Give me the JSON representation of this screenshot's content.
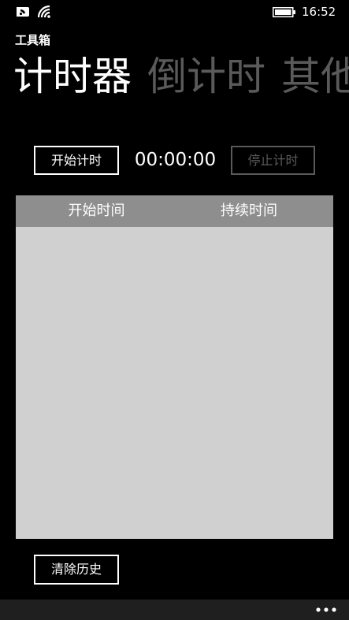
{
  "status_bar": {
    "time": "16:52",
    "icons": [
      "signal-icon",
      "wifi-icon",
      "battery-icon"
    ]
  },
  "app": {
    "title": "工具箱"
  },
  "pivot": {
    "items": [
      {
        "label": "计时器",
        "active": true
      },
      {
        "label": "倒计时",
        "active": false
      },
      {
        "label": "其他",
        "active": false
      }
    ]
  },
  "timer": {
    "start_label": "开始计时",
    "display": "00:00:00",
    "stop_label": "停止计时",
    "stop_enabled": false
  },
  "history": {
    "columns": [
      "开始时间",
      "持续时间"
    ],
    "rows": []
  },
  "actions": {
    "clear_label": "清除历史"
  },
  "app_bar": {
    "more_icon": "more-dots-icon"
  },
  "colors": {
    "background": "#000000",
    "text": "#ffffff",
    "disabled": "#5a5a5a",
    "list_header": "#8e8e8e",
    "list_body": "#d0d0d0",
    "app_bar": "#1f1f1f"
  }
}
